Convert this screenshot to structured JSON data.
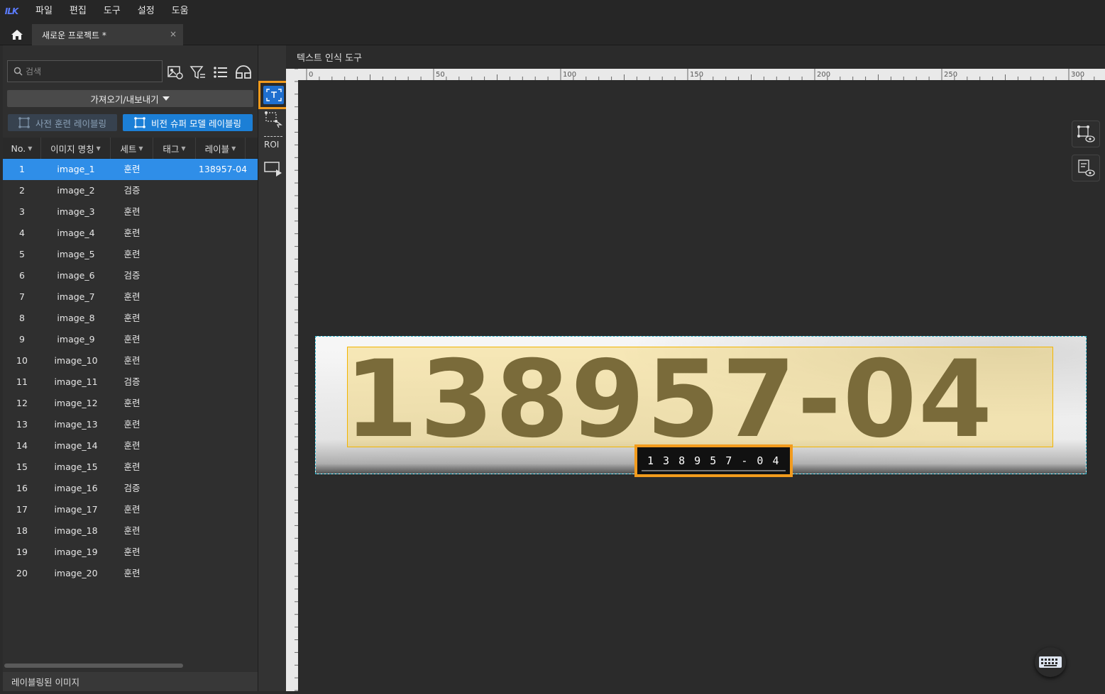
{
  "app": {
    "logo_text": "ILK"
  },
  "menu": [
    "파일",
    "편집",
    "도구",
    "설정",
    "도움"
  ],
  "tab": {
    "title": "새로운 프로젝트 *",
    "close": "×"
  },
  "left": {
    "search_placeholder": "검색",
    "import_export": "가져오기/내보내기",
    "btn_pretrained": "사전 훈련 레이블링",
    "btn_vision_super": "비전 슈퍼 모델 레이블링",
    "columns": [
      "No.",
      "이미지 명칭",
      "세트",
      "태그",
      "레이블"
    ],
    "rows": [
      {
        "no": "1",
        "name": "image_1",
        "set": "훈련",
        "label": "138957-04",
        "selected": true
      },
      {
        "no": "2",
        "name": "image_2",
        "set": "검증",
        "label": ""
      },
      {
        "no": "3",
        "name": "image_3",
        "set": "훈련",
        "label": ""
      },
      {
        "no": "4",
        "name": "image_4",
        "set": "훈련",
        "label": ""
      },
      {
        "no": "5",
        "name": "image_5",
        "set": "훈련",
        "label": ""
      },
      {
        "no": "6",
        "name": "image_6",
        "set": "검증",
        "label": ""
      },
      {
        "no": "7",
        "name": "image_7",
        "set": "훈련",
        "label": ""
      },
      {
        "no": "8",
        "name": "image_8",
        "set": "훈련",
        "label": ""
      },
      {
        "no": "9",
        "name": "image_9",
        "set": "훈련",
        "label": ""
      },
      {
        "no": "10",
        "name": "image_10",
        "set": "훈련",
        "label": ""
      },
      {
        "no": "11",
        "name": "image_11",
        "set": "검증",
        "label": ""
      },
      {
        "no": "12",
        "name": "image_12",
        "set": "훈련",
        "label": ""
      },
      {
        "no": "13",
        "name": "image_13",
        "set": "훈련",
        "label": ""
      },
      {
        "no": "14",
        "name": "image_14",
        "set": "훈련",
        "label": ""
      },
      {
        "no": "15",
        "name": "image_15",
        "set": "훈련",
        "label": ""
      },
      {
        "no": "16",
        "name": "image_16",
        "set": "검증",
        "label": ""
      },
      {
        "no": "17",
        "name": "image_17",
        "set": "훈련",
        "label": ""
      },
      {
        "no": "18",
        "name": "image_18",
        "set": "훈련",
        "label": ""
      },
      {
        "no": "19",
        "name": "image_19",
        "set": "훈련",
        "label": ""
      },
      {
        "no": "20",
        "name": "image_20",
        "set": "훈련",
        "label": ""
      }
    ],
    "footer": "레이블링된 이미지"
  },
  "tools": [
    "text-box-tool-icon",
    "point-select-tool-icon",
    "roi-tool-icon",
    "next-image-tool-icon"
  ],
  "canvas": {
    "title": "텍스트 인식 도구",
    "ruler_labels": [
      "0",
      "50",
      "100",
      "150",
      "200",
      "250",
      "300"
    ],
    "image_text": "138957-04",
    "label_text": "1 3 8 9 5 7 - 0 4"
  },
  "colors": {
    "accent": "#f29b1d",
    "selection": "#2f8ee8",
    "primary_button": "#1c7fd6",
    "label_fill": "#f6d050"
  }
}
